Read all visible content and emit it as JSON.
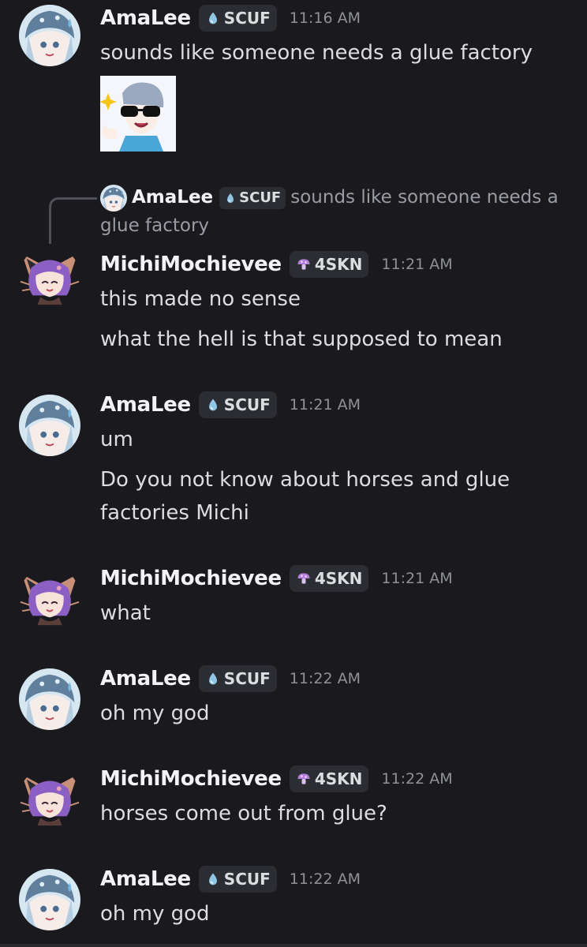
{
  "messages": [
    {
      "author": "AmaLee",
      "tag": "SCUF",
      "time": "11:16 AM",
      "lines": [
        "sounds like someone needs a glue factory"
      ],
      "has_sticker": true
    },
    {
      "reply": {
        "author": "AmaLee",
        "tag": "SCUF",
        "text": "sounds like someone needs a glue factory"
      },
      "author": "MichiMochievee",
      "tag": "4SKN",
      "time": "11:21 AM",
      "lines": [
        "this made no sense",
        "what the hell is that supposed to mean"
      ]
    },
    {
      "author": "AmaLee",
      "tag": "SCUF",
      "time": "11:21 AM",
      "lines": [
        "um",
        "Do you not know about horses and glue factories Michi"
      ]
    },
    {
      "author": "MichiMochievee",
      "tag": "4SKN",
      "time": "11:21 AM",
      "lines": [
        "what"
      ]
    },
    {
      "author": "AmaLee",
      "tag": "SCUF",
      "time": "11:22 AM",
      "lines": [
        "oh my god"
      ]
    },
    {
      "author": "MichiMochievee",
      "tag": "4SKN",
      "time": "11:22 AM",
      "lines": [
        "horses come out from glue?"
      ]
    },
    {
      "author": "AmaLee",
      "tag": "SCUF",
      "time": "11:22 AM",
      "lines": [
        "oh my god"
      ]
    }
  ],
  "colors": {
    "background": "#1a1a1e",
    "username": "#f2f3f5",
    "message_text": "#dcdde1",
    "timestamp": "#8e9297",
    "tag_background": "#2c2d32",
    "scuf_icon": "#8fc6e6",
    "skn_icon": "#b27ddb"
  },
  "icons": {
    "scuf_tag_icon": "water-drop-icon",
    "skn_tag_icon": "mushroom-icon"
  }
}
